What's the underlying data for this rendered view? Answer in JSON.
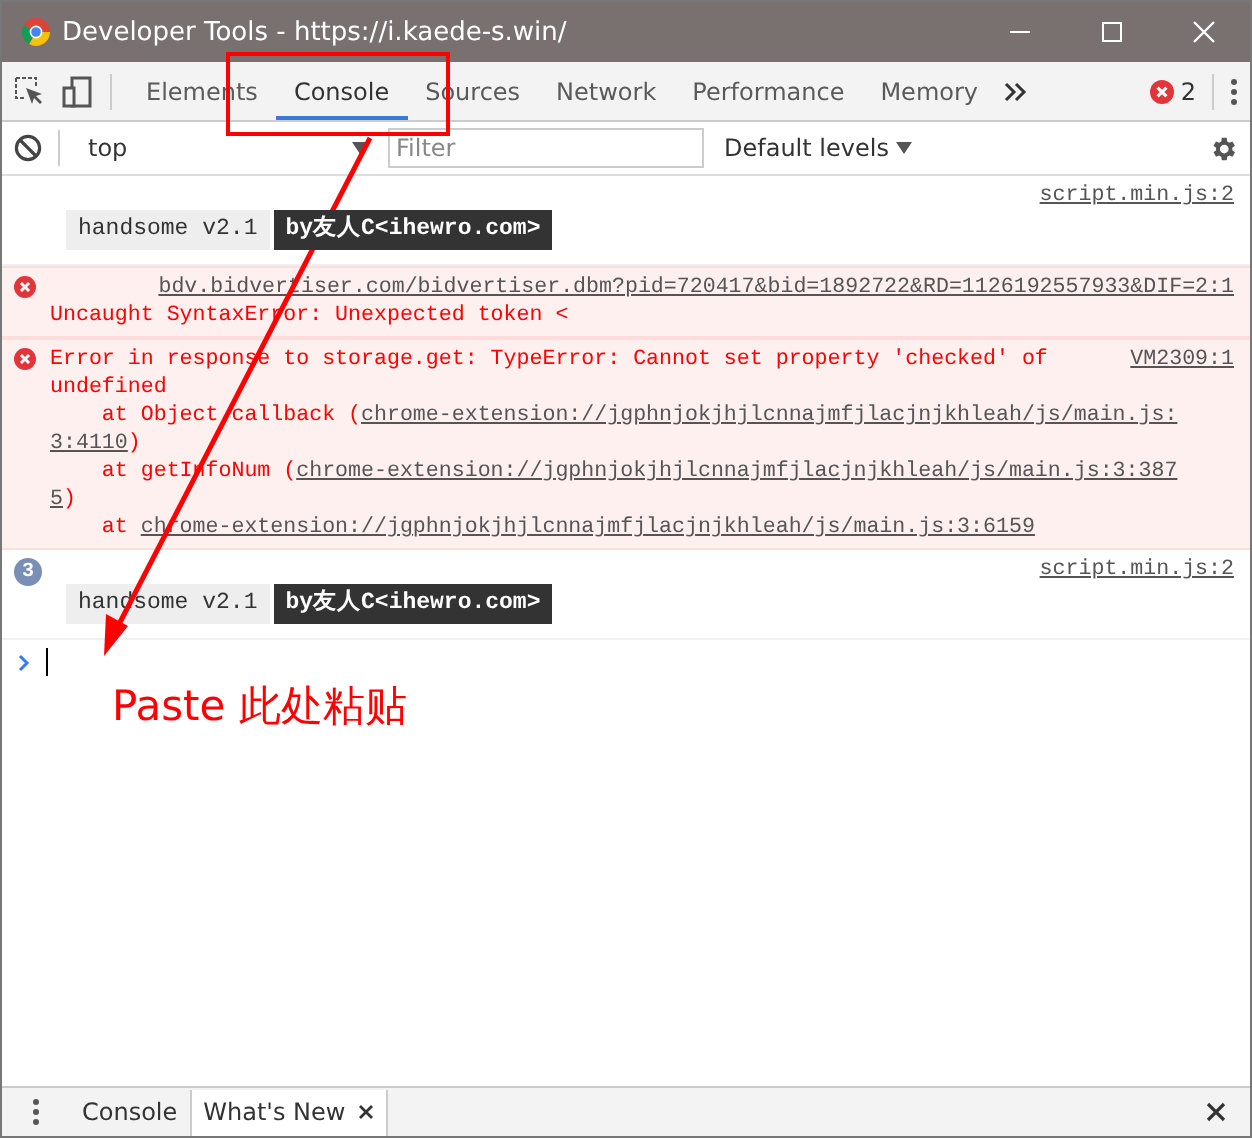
{
  "window": {
    "title": "Developer Tools - https://i.kaede-s.win/"
  },
  "tabs": [
    {
      "label": "Elements",
      "selected": false
    },
    {
      "label": "Console",
      "selected": true
    },
    {
      "label": "Sources",
      "selected": false
    },
    {
      "label": "Network",
      "selected": false
    },
    {
      "label": "Performance",
      "selected": false
    },
    {
      "label": "Memory",
      "selected": false
    }
  ],
  "error_count": "2",
  "console_toolbar": {
    "context": "top",
    "filter_placeholder": "Filter",
    "levels": "Default levels"
  },
  "messages": [
    {
      "kind": "log",
      "source": "script.min.js:2",
      "badges": [
        {
          "kind": "light",
          "text": "handsome v2.1"
        },
        {
          "kind": "dark",
          "text": "by友人C<ihewro.com>"
        }
      ]
    },
    {
      "kind": "error",
      "source": "bdv.bidvertiser.com/bidvertiser.dbm?pid=720417&bid=1892722&RD=1126192557933&DIF=2:1",
      "text": "Uncaught SyntaxError: Unexpected token <"
    },
    {
      "kind": "error",
      "source": "VM2309:1",
      "text": "Error in response to storage.get: TypeError: Cannot set property 'checked' of",
      "lines": [
        [
          {
            "t": "undefined"
          }
        ],
        [
          {
            "t": "    at Object.callback ("
          },
          {
            "link": "chrome-extension://jgphnjokjhjlcnnajmfjlacjnjkhleah/js/main.js:"
          }
        ],
        [
          {
            "link": "3:4110"
          },
          {
            "t": ")"
          }
        ],
        [
          {
            "t": "    at getInfoNum ("
          },
          {
            "link": "chrome-extension://jgphnjokjhjlcnnajmfjlacjnjkhleah/js/main.js:3:387"
          }
        ],
        [
          {
            "link": "5"
          },
          {
            "t": ")"
          }
        ],
        [
          {
            "t": "    at "
          },
          {
            "link": "chrome-extension://jgphnjokjhjlcnnajmfjlacjnjkhleah/js/main.js:3:6159"
          }
        ]
      ]
    },
    {
      "kind": "log",
      "count": "3",
      "source": "script.min.js:2",
      "badges": [
        {
          "kind": "light",
          "text": "handsome v2.1"
        },
        {
          "kind": "dark",
          "text": "by友人C<ihewro.com>"
        }
      ]
    }
  ],
  "annotation": {
    "text": "Paste 此处粘贴"
  },
  "drawer": {
    "tabs": [
      {
        "label": "Console",
        "selected": false,
        "closable": false
      },
      {
        "label": "What's New",
        "selected": true,
        "closable": true
      }
    ]
  }
}
